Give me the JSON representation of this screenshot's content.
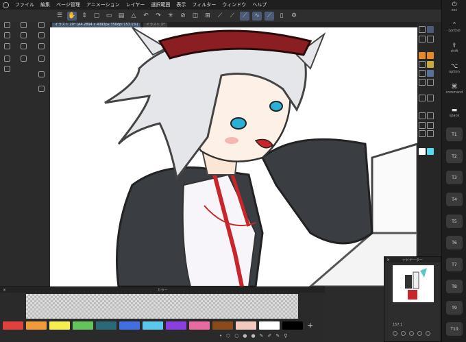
{
  "menubar": {
    "items": [
      "ファイル",
      "編集",
      "ページ管理",
      "アニメーション",
      "レイヤー",
      "選択範囲",
      "表示",
      "フィルター",
      "ウィンドウ",
      "ヘルプ"
    ]
  },
  "tabs": [
    {
      "label": "イラスト 29* (A4 2894 x 4093px 350dpi 157.1%)"
    },
    {
      "label": "イラスト 3*"
    }
  ],
  "color_panel": {
    "title": "カラー",
    "close": "✕",
    "add": "+",
    "swatches": [
      "#e0403e",
      "#f09a3a",
      "#f5ee4e",
      "#62c45a",
      "#2a6a78",
      "#3f6fe0",
      "#5ac8ee",
      "#8a3fe0",
      "#e86aa0",
      "#8a4a1c",
      "#f2c8bf",
      "#ffffff",
      "#000000"
    ]
  },
  "navigator": {
    "title": "ナビゲーター",
    "close": "✕",
    "zoom": "157.1"
  },
  "keys": {
    "esc": "esc",
    "control": "control",
    "shift": "shift",
    "option": "option",
    "command": "command",
    "space": "space",
    "tkeys": [
      "T1",
      "T2",
      "T3",
      "T4",
      "T5",
      "T6",
      "T7",
      "T8",
      "T9",
      "T10"
    ]
  },
  "colors": {
    "accent": "#4a5a77",
    "canvas": "#ffffff",
    "hair": "#e4e6ea",
    "jacket": "#3a3d42",
    "headband": "#8a1e22"
  }
}
